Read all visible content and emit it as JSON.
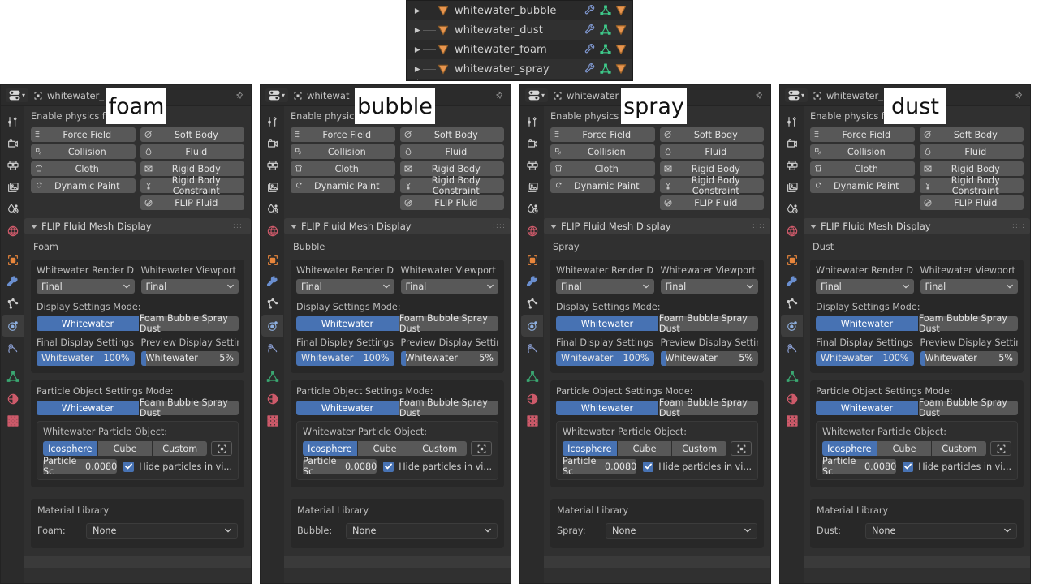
{
  "outliner": {
    "rows": [
      {
        "name": "whitewater_bubble",
        "icons": [
          "wrench-icon",
          "mesh-data-icon",
          "object-data-icon"
        ]
      },
      {
        "name": "whitewater_dust",
        "icons": [
          "wrench-icon",
          "mesh-data-icon",
          "object-data-icon"
        ]
      },
      {
        "name": "whitewater_foam",
        "icons": [
          "wrench-icon",
          "mesh-data-icon",
          "object-data-icon"
        ]
      },
      {
        "name": "whitewater_spray",
        "icons": [
          "wrench-icon",
          "mesh-data-icon",
          "object-data-icon"
        ]
      }
    ]
  },
  "overlays": [
    {
      "text": "foam"
    },
    {
      "text": "bubble"
    },
    {
      "text": "spray"
    },
    {
      "text": "dust"
    }
  ],
  "common": {
    "breadcrumb_object": "whitewater_",
    "enable_physics_label": "Enable physics for:",
    "physics_left": [
      {
        "label": "Force Field",
        "icon": "force-field-icon"
      },
      {
        "label": "Collision",
        "icon": "collision-icon"
      },
      {
        "label": "Cloth",
        "icon": "cloth-icon"
      },
      {
        "label": "Dynamic Paint",
        "icon": "dynamic-paint-icon"
      }
    ],
    "physics_right": [
      {
        "label": "Soft Body",
        "icon": "soft-body-icon"
      },
      {
        "label": "Fluid",
        "icon": "fluid-icon"
      },
      {
        "label": "Rigid Body",
        "icon": "rigid-body-icon"
      },
      {
        "label": "Rigid Body Constraint",
        "icon": "rigid-body-constraint-icon"
      },
      {
        "label": "FLIP Fluid",
        "icon": "flip-fluid-icon"
      }
    ],
    "section_title": "FLIP Fluid Mesh Display",
    "render_display_label": "Whitewater Render Displ...",
    "viewport_display_label": "Whitewater Viewport Di...",
    "render_display_value": "Final",
    "viewport_display_value": "Final",
    "display_settings_mode_label": "Display Settings Mode:",
    "mode_option_a": "Whitewater",
    "mode_option_b": "Foam Bubble Spray Dust",
    "final_display_label": "Final Display Settings:",
    "preview_display_label": "Preview Display Settings:",
    "final_slider_name": "Whitewater",
    "final_slider_value": "100%",
    "final_slider_percent": 100,
    "preview_slider_name": "Whitewater",
    "preview_slider_value": "5%",
    "preview_slider_percent": 5,
    "particle_object_mode_label": "Particle Object Settings Mode:",
    "particle_object_label": "Whitewater Particle Object:",
    "obj_option_a": "Icosphere",
    "obj_option_b": "Cube",
    "obj_option_c": "Custom",
    "particle_scale_label": "Particle Sc",
    "particle_scale_value": "0.0080",
    "hide_particles_label": "Hide particles in vi...",
    "material_library_label": "Material Library",
    "material_value": "None",
    "accent_blue": "#4772b3",
    "panel_bg": "#303030",
    "box_bg": "#282828",
    "button_bg": "#585858"
  },
  "panels": [
    {
      "id": "foam",
      "object_name": "whitewater_",
      "subname": "Foam",
      "material_label": "Foam:"
    },
    {
      "id": "bubble",
      "object_name": "whitewat",
      "subname": "Bubble",
      "material_label": "Bubble:"
    },
    {
      "id": "spray",
      "object_name": "whitewater",
      "subname": "Spray",
      "material_label": "Spray:"
    },
    {
      "id": "dust",
      "object_name": "whitewater_",
      "subname": "Dust",
      "material_label": "Dust:"
    }
  ],
  "tabs": [
    {
      "name": "tool-tab",
      "selected": false
    },
    {
      "name": "render-tab",
      "selected": false
    },
    {
      "name": "output-tab",
      "selected": false
    },
    {
      "name": "view-layer-tab",
      "selected": false
    },
    {
      "name": "scene-tab",
      "selected": false
    },
    {
      "name": "world-tab",
      "selected": false
    },
    {
      "name": "object-tab",
      "selected": false
    },
    {
      "name": "modifier-tab",
      "selected": false
    },
    {
      "name": "particles-tab",
      "selected": false
    },
    {
      "name": "physics-tab",
      "selected": true
    },
    {
      "name": "constraints-tab",
      "selected": false
    },
    {
      "name": "object-data-tab",
      "selected": false
    },
    {
      "name": "material-tab",
      "selected": false
    },
    {
      "name": "texture-tab",
      "selected": false
    }
  ]
}
